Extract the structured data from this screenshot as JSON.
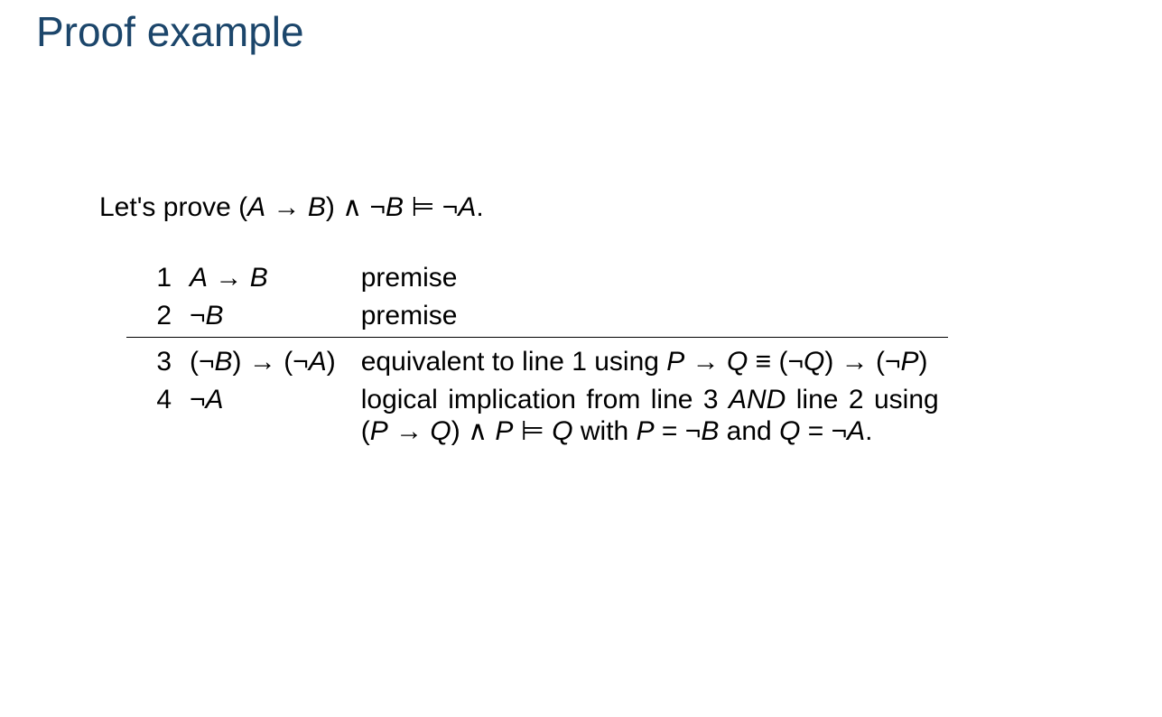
{
  "title": "Proof example",
  "intro": {
    "prefix": "Let's prove (",
    "A": "A",
    "arrow1": " → ",
    "B": "B",
    "afterParen": ") ∧ ¬",
    "B2": "B",
    "entails": " ⊨ ¬",
    "A2": "A",
    "period": "."
  },
  "rows": [
    {
      "num": "1",
      "formula": {
        "p1": "A",
        "arrow": " → ",
        "p2": "B"
      },
      "just": {
        "text": "premise"
      }
    },
    {
      "num": "2",
      "formula": {
        "neg": "¬",
        "p1": "B"
      },
      "just": {
        "text": "premise"
      }
    },
    {
      "num": "3",
      "formula": {
        "open1": "(¬",
        "p1": "B",
        "close1": ") → (¬",
        "p2": "A",
        "close2": ")"
      },
      "just": {
        "t1": "equivalent to line 1 using ",
        "P": "P",
        "arrow": " → ",
        "Q": "Q",
        "equiv": " ≡ (¬",
        "Q2": "Q",
        "mid": ") → (¬",
        "P2": "P",
        "end": ")"
      }
    },
    {
      "num": "4",
      "formula": {
        "neg": "¬",
        "p1": "A"
      },
      "just": {
        "t1": "logical implication from line 3 ",
        "and": "AND",
        "t2": " line 2 using (",
        "P": "P",
        "arrow": " → ",
        "Q": "Q",
        "t3": ") ∧ ",
        "P2": "P",
        "t4": " ⊨ ",
        "Q2": "Q",
        "t5": " with ",
        "P3": "P",
        "eq1": " = ¬",
        "B": "B",
        "t6": " and ",
        "Q3": "Q",
        "eq2": " = ¬",
        "A": "A",
        "t7": "."
      }
    }
  ]
}
